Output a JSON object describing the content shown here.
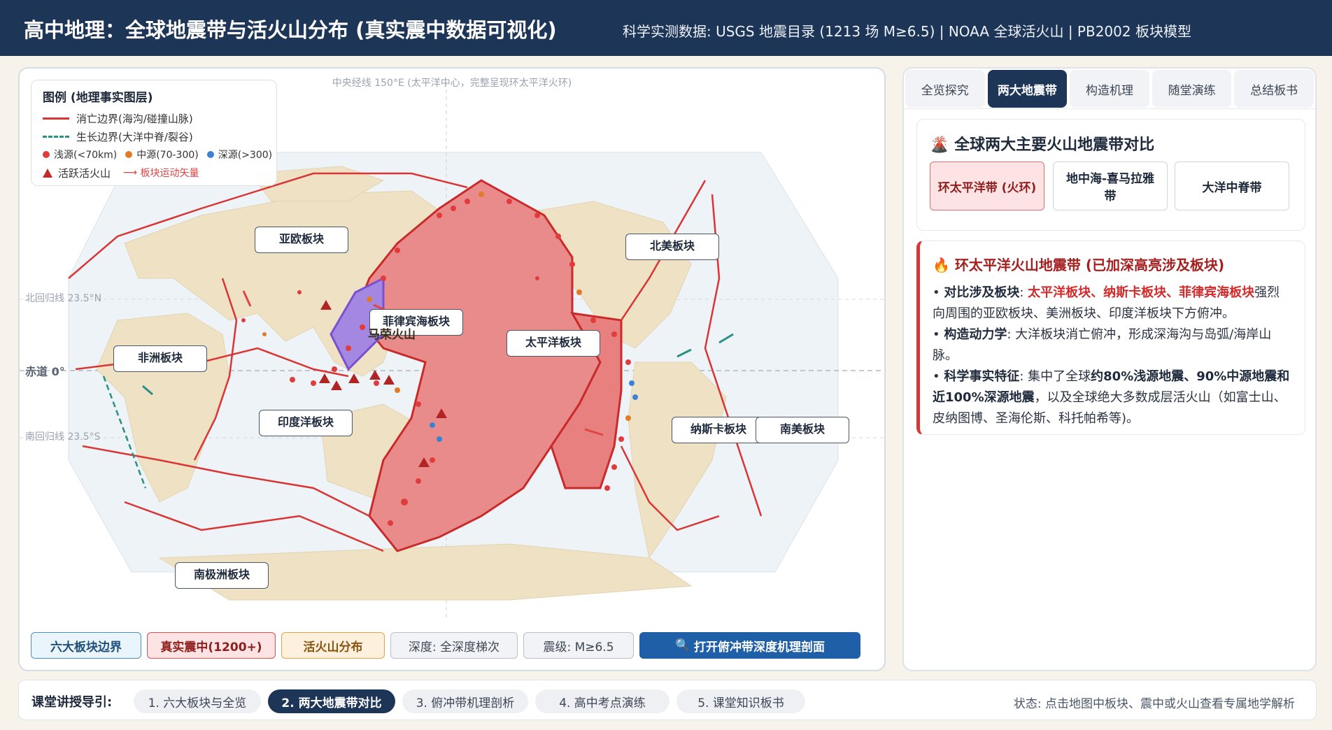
{
  "header": {
    "title": "高中地理：全球地震带与活火山分布 (真实震中数据可视化)",
    "subtitle": "科学实测数据: USGS 地震目录 (1213 场 M≥6.5) | NOAA 全球活火山 | PB2002 板块模型"
  },
  "map": {
    "note": "中央经线 150°E (太平洋中心，完整呈现环太平洋火环)",
    "lat_labels": {
      "tropic_n": "北回归线 23.5°N",
      "equator": "赤道 0°",
      "tropic_s": "南回归线 23.5°S"
    },
    "legend": {
      "title": "图例 (地理事实图层)",
      "subduction": "消亡边界(海沟/碰撞山脉)",
      "divergent": "生长边界(大洋中脊/裂谷)",
      "shallow": "浅源(<70km)",
      "intermediate": "中源(70-300)",
      "deep": "深源(>300)",
      "volcano": "活跃活火山",
      "vector": "板块运动矢量"
    },
    "plates": {
      "eurasian": "亚欧板块",
      "north_american": "北美板块",
      "philippine": "菲律宾海板块",
      "pacific": "太平洋板块",
      "african": "非洲板块",
      "indian": "印度洋板块",
      "nazca": "纳斯卡板块",
      "south_american": "南美板块",
      "antarctic": "南极洲板块"
    },
    "volcano_tag": "马荣火山",
    "colors": {
      "convergent": "#d93535",
      "divergent": "#2a8f84",
      "shallow": "#e03c3c",
      "intermediate": "#e07b2a",
      "deep": "#3b82d6",
      "land": "#efe2c4",
      "ocean": "#eef3f7"
    },
    "toolbar": {
      "boundaries": "六大板块边界",
      "quakes": "真实震中(1200+)",
      "volcanoes": "活火山分布",
      "depth": "深度: 全深度梯次",
      "magnitude": "震级: M≥6.5",
      "profile": "打开俯冲带深度机理剖面"
    }
  },
  "side": {
    "tabs": [
      "全览探究",
      "两大地震带",
      "构造机理",
      "随堂演练",
      "总结板书"
    ],
    "active_tab": 1,
    "card_title": "全球两大主要火山地震带对比",
    "belts": [
      "环太平洋带 (火环)",
      "地中海-喜马拉雅带",
      "大洋中脊带"
    ],
    "detail": {
      "title": "环太平洋火山地震带 (已加深高亮涉及板块)",
      "p1_label": "对比涉及板块",
      "p1_plates": "太平洋板块、纳斯卡板块、菲律宾海板块",
      "p1_rest": "强烈向周围的亚欧板块、美洲板块、印度洋板块下方俯冲。",
      "p2_label": "构造动力学",
      "p2_text": "大洋板块消亡俯冲，形成深海沟与岛弧/海岸山脉。",
      "p3_label": "科学事实特征",
      "p3_pre": "集中了全球",
      "p3_bold": "约80%浅源地震、90%中源地震和近100%深源地震",
      "p3_post": "，以及全球绝大多数成层活火山（如富士山、皮纳图博、圣海伦斯、科托帕希等)。"
    }
  },
  "footer": {
    "guide": "课堂讲授导引:",
    "steps": [
      "1. 六大板块与全览",
      "2. 两大地震带对比",
      "3. 俯冲带机理剖析",
      "4. 高中考点演练",
      "5. 课堂知识板书"
    ],
    "active_step": 1,
    "status": "状态: 点击地图中板块、震中或火山查看专属地学解析"
  }
}
